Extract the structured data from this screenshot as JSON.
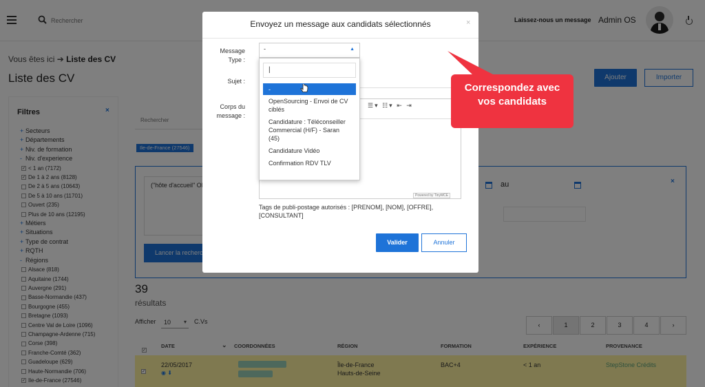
{
  "header": {
    "search_placeholder": "Rechercher",
    "message_link": "Laissez-nous un message",
    "user_name": "Admin OS"
  },
  "breadcrumb": {
    "prefix": "Vous êtes ici",
    "current": "Liste des CV"
  },
  "page": {
    "title": "Liste des CV",
    "add_label": "Ajouter",
    "import_label": "Importer"
  },
  "filters": {
    "title": "Filtres",
    "close": "×",
    "items": [
      {
        "mark": "+",
        "label": "Secteurs",
        "type": "group"
      },
      {
        "mark": "+",
        "label": "Départements",
        "type": "group"
      },
      {
        "mark": "+",
        "label": "Niv. de formation",
        "type": "group"
      },
      {
        "mark": "-",
        "label": "Niv. d'experience",
        "type": "group"
      },
      {
        "mark": "☑",
        "label": "< 1 an (7172)",
        "type": "sub"
      },
      {
        "mark": "☑",
        "label": "De 1 à 2 ans (8128)",
        "type": "sub"
      },
      {
        "mark": "☐",
        "label": "De 2 à 5 ans (10643)",
        "type": "sub"
      },
      {
        "mark": "☐",
        "label": "De 5 à 10 ans (11701)",
        "type": "sub"
      },
      {
        "mark": "☐",
        "label": "Ouvert (235)",
        "type": "sub"
      },
      {
        "mark": "☐",
        "label": "Plus de 10 ans (12195)",
        "type": "sub"
      },
      {
        "mark": "+",
        "label": "Métiers",
        "type": "group"
      },
      {
        "mark": "+",
        "label": "Situations",
        "type": "group"
      },
      {
        "mark": "+",
        "label": "Type de contrat",
        "type": "group"
      },
      {
        "mark": "+",
        "label": "RQTH",
        "type": "group"
      },
      {
        "mark": "-",
        "label": "Régions",
        "type": "group"
      },
      {
        "mark": "☐",
        "label": "Alsace (818)",
        "type": "sub"
      },
      {
        "mark": "☐",
        "label": "Aquitaine (1744)",
        "type": "sub"
      },
      {
        "mark": "☐",
        "label": "Auvergne (291)",
        "type": "sub"
      },
      {
        "mark": "☐",
        "label": "Basse-Normandie (437)",
        "type": "sub"
      },
      {
        "mark": "☐",
        "label": "Bourgogne (455)",
        "type": "sub"
      },
      {
        "mark": "☐",
        "label": "Bretagne (1093)",
        "type": "sub"
      },
      {
        "mark": "☐",
        "label": "Centre Val de Loire (1096)",
        "type": "sub"
      },
      {
        "mark": "☐",
        "label": "Champagne-Ardenne (715)",
        "type": "sub"
      },
      {
        "mark": "☐",
        "label": "Corse (398)",
        "type": "sub"
      },
      {
        "mark": "☐",
        "label": "Franche-Comté (362)",
        "type": "sub"
      },
      {
        "mark": "☐",
        "label": "Guadeloupe (629)",
        "type": "sub"
      },
      {
        "mark": "☐",
        "label": "Haute-Normandie (706)",
        "type": "sub"
      },
      {
        "mark": "☑",
        "label": "Ile-de-France (27546)",
        "type": "sub"
      }
    ]
  },
  "main": {
    "search_placeholder": "Rechercher",
    "active_tag": "Ile-de-France (27546)",
    "criteria_text": "(\"hôte d'accueil\" OR",
    "date_to_label": "au",
    "criteria_close": "×",
    "launch_label": "Lancer la recherche",
    "count": "39",
    "results_label": "résultats",
    "show_label": "Afficher",
    "per_page": "10",
    "per_page_suffix": "C.Vs",
    "pager": [
      "‹",
      "1",
      "2",
      "3",
      "4",
      "›"
    ],
    "columns": [
      "DATE",
      "COORDONNÉES",
      "RÉGION",
      "FORMATION",
      "EXPÉRIENCE",
      "PROVENANCE"
    ],
    "row": {
      "date": "22/05/2017",
      "region_line1": "Île-de-France",
      "region_line2": "Hauts-de-Seine",
      "formation": "BAC+4",
      "experience": "< 1 an",
      "provenance": "StepStone Crédits"
    }
  },
  "modal": {
    "title": "Envoyez un message aux candidats sélectionnés",
    "close": "×",
    "type_label_1": "Message",
    "type_label_2": "Type :",
    "type_value": "-",
    "subject_label": "Sujet :",
    "body_label_1": "Corps du",
    "body_label_2": "message :",
    "powered_by": "Powered by TinyMCE",
    "tags_text": "Tags de publi-postage autorisés : [PRENOM], [NOM], [OFFRE], [CONSULTANT]",
    "validate_label": "Valider",
    "cancel_label": "Annuler"
  },
  "dropdown": {
    "search_value": "|",
    "options": [
      "-",
      "OpenSourcing - Envoi de CV ciblés",
      "Candidature : Téléconseiller Commercial (H/F) - Saran (45)",
      "Candidature Vidéo",
      "Confirmation RDV TLV"
    ]
  },
  "callout": {
    "text": "Correspondez avec vos candidats",
    "color": "#ef3340"
  },
  "colors": {
    "accent": "#1e73d8",
    "row_highlight": "#fff3a0"
  }
}
